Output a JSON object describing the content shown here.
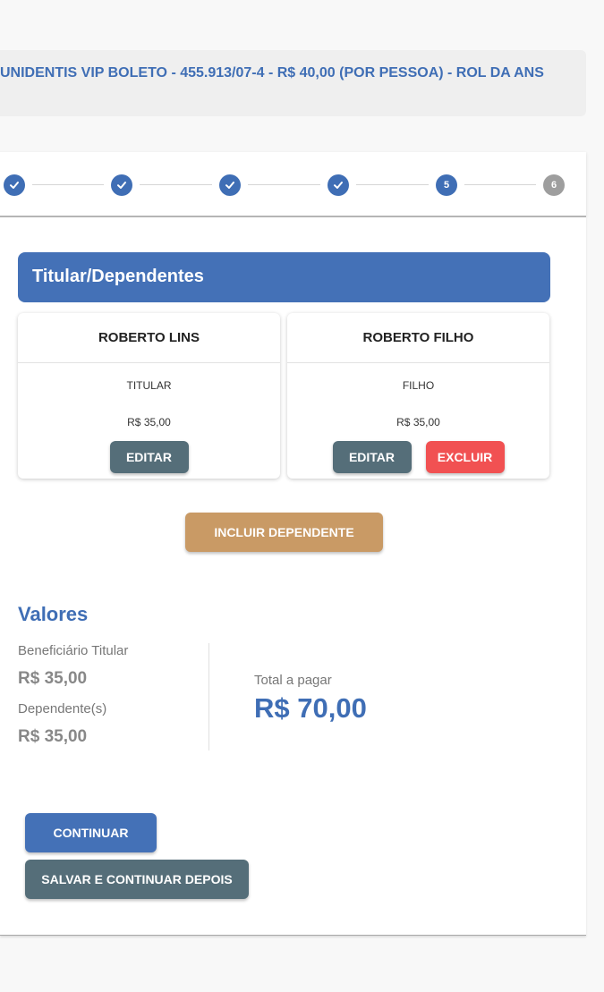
{
  "plan": {
    "title": "UNIDENTIS VIP BOLETO - 455.913/07-4 - R$ 40,00 (POR PESSOA) - ROL DA ANS"
  },
  "stepper": {
    "steps": [
      {
        "label": "1",
        "status": "done"
      },
      {
        "label": "2",
        "status": "done"
      },
      {
        "label": "3",
        "status": "done"
      },
      {
        "label": "4",
        "status": "done"
      },
      {
        "label": "5",
        "status": "current"
      },
      {
        "label": "6",
        "status": "pending"
      }
    ]
  },
  "members": {
    "title": "Titular/Dependentes",
    "items": [
      {
        "name": "ROBERTO LINS",
        "role": "TITULAR",
        "price": "R$ 35,00",
        "edit_label": "EDITAR"
      },
      {
        "name": "ROBERTO FILHO",
        "role": "FILHO",
        "price": "R$ 35,00",
        "edit_label": "EDITAR",
        "delete_label": "EXCLUIR"
      }
    ],
    "add_label": "INCLUIR DEPENDENTE"
  },
  "values": {
    "title": "Valores",
    "holder_label": "Beneficiário Titular",
    "holder_amount": "R$ 35,00",
    "dependents_label": "Dependente(s)",
    "dependents_amount": "R$ 35,00",
    "total_label": "Total a pagar",
    "total_amount": "R$ 70,00"
  },
  "actions": {
    "continue_label": "CONTINUAR",
    "save_label": "SALVAR E CONTINUAR DEPOIS"
  },
  "colors": {
    "primary": "#4471b7",
    "secondary": "#556e79",
    "danger": "#f15152",
    "add": "#c99a65",
    "pending_step": "#9e9e9e"
  }
}
